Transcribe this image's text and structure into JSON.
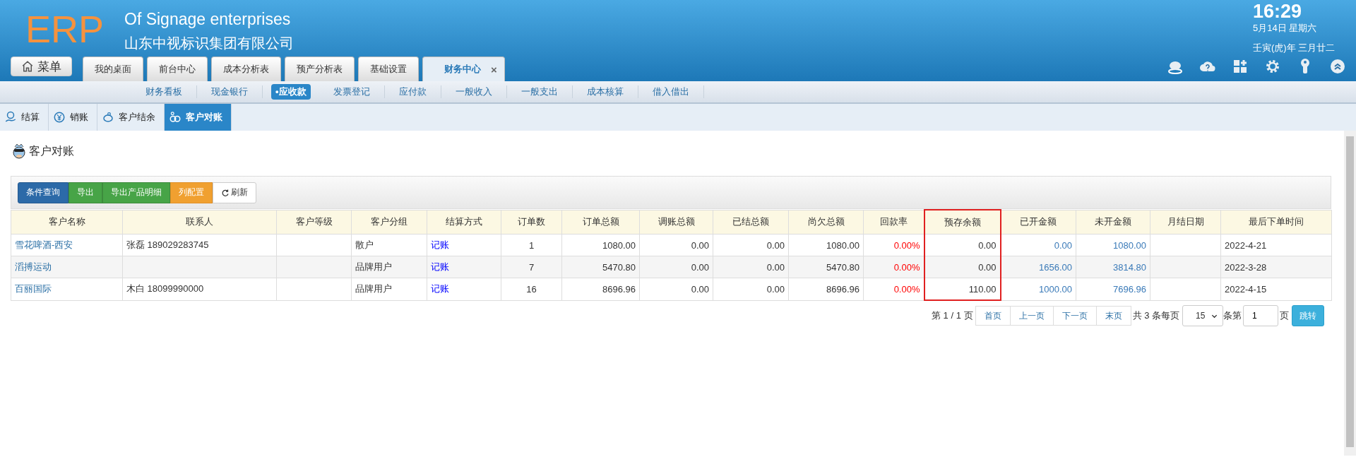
{
  "header": {
    "logo": "ERP",
    "title_en": "Of Signage enterprises",
    "title_cn": "山东中视标识集团有限公司",
    "menu_button": "菜单",
    "clock": {
      "time": "16:29",
      "date": "5月14日 星期六",
      "lunar": "壬寅(虎)年 三月廿二"
    },
    "tabs": [
      {
        "label": "我的桌面",
        "selected": false
      },
      {
        "label": "前台中心",
        "selected": false
      },
      {
        "label": "成本分析表",
        "selected": false
      },
      {
        "label": "预产分析表",
        "selected": false
      },
      {
        "label": "基础设置",
        "selected": false
      },
      {
        "label": "财务中心",
        "selected": true,
        "close": "×"
      }
    ],
    "tools": [
      {
        "kind": "chat"
      },
      {
        "kind": "help"
      },
      {
        "kind": "apps"
      },
      {
        "kind": "settings"
      },
      {
        "kind": "key"
      },
      {
        "kind": "collapse"
      }
    ]
  },
  "submenu": [
    {
      "label": "财务看板",
      "selected": false
    },
    {
      "label": "现金银行",
      "selected": false
    },
    {
      "label": "•应收款",
      "selected": true
    },
    {
      "label": "发票登记",
      "selected": false
    },
    {
      "label": "应付款",
      "selected": false
    },
    {
      "label": "一般收入",
      "selected": false
    },
    {
      "label": "一般支出",
      "selected": false
    },
    {
      "label": "成本核算",
      "selected": false
    },
    {
      "label": "借入借出",
      "selected": false
    }
  ],
  "subtabs": [
    {
      "label": "结算",
      "selected": false
    },
    {
      "label": "销账",
      "selected": false
    },
    {
      "label": "客户结余",
      "selected": false
    },
    {
      "label": "客户对账",
      "selected": true
    }
  ],
  "page_title": "客户对账",
  "toolbar": [
    {
      "label": "条件查询",
      "kind": "primary"
    },
    {
      "label": "导出",
      "kind": "success"
    },
    {
      "label": "导出产品明细",
      "kind": "success"
    },
    {
      "label": "列配置",
      "kind": "warning"
    },
    {
      "label": "刷新",
      "kind": "refresh"
    }
  ],
  "table": {
    "columns": [
      {
        "label": "客户名称",
        "kind": "link",
        "highlighted": false
      },
      {
        "label": "联系人",
        "kind": "text",
        "highlighted": false
      },
      {
        "label": "客户等级",
        "kind": "text",
        "highlighted": false
      },
      {
        "label": "客户分组",
        "kind": "text",
        "highlighted": false
      },
      {
        "label": "结算方式",
        "kind": "method",
        "highlighted": false
      },
      {
        "label": "订单数",
        "kind": "center",
        "highlighted": false
      },
      {
        "label": "订单总额",
        "kind": "number",
        "highlighted": false
      },
      {
        "label": "调账总额",
        "kind": "number",
        "highlighted": false
      },
      {
        "label": "已结总额",
        "kind": "number",
        "highlighted": false
      },
      {
        "label": "尚欠总额",
        "kind": "number",
        "highlighted": false
      },
      {
        "label": "回款率",
        "kind": "rate",
        "highlighted": false
      },
      {
        "label": "预存余额",
        "kind": "number",
        "highlighted": true
      },
      {
        "label": "已开金额",
        "kind": "amount-link",
        "highlighted": false
      },
      {
        "label": "未开金额",
        "kind": "amount-link",
        "highlighted": false
      },
      {
        "label": "月结日期",
        "kind": "text",
        "highlighted": false
      },
      {
        "label": "最后下单时间",
        "kind": "text",
        "highlighted": false
      }
    ],
    "rows": [
      [
        "雪花啤酒-西安",
        "张磊 189029283745",
        "",
        "散户",
        "记账",
        "1",
        "1080.00",
        "0.00",
        "0.00",
        "1080.00",
        "0.00%",
        "0.00",
        "0.00",
        "1080.00",
        "",
        "2022-4-21"
      ],
      [
        "滔搏运动",
        "",
        "",
        "品牌用户",
        "记账",
        "7",
        "5470.80",
        "0.00",
        "0.00",
        "5470.80",
        "0.00%",
        "0.00",
        "1656.00",
        "3814.80",
        "",
        "2022-3-28"
      ],
      [
        "百丽国际",
        "木白 18099990000",
        "",
        "品牌用户",
        "记账",
        "16",
        "8696.96",
        "0.00",
        "0.00",
        "8696.96",
        "0.00%",
        "110.00",
        "1000.00",
        "7696.96",
        "",
        "2022-4-15"
      ]
    ]
  },
  "pager": {
    "summary": "第 1 / 1 页",
    "buttons": [
      "首页",
      "上一页",
      "下一页",
      "末页"
    ],
    "total": "共 3 条每页",
    "page_size": "15",
    "page_label": "条第",
    "page_input": "1",
    "page_suffix": "页",
    "go": "跳转"
  }
}
